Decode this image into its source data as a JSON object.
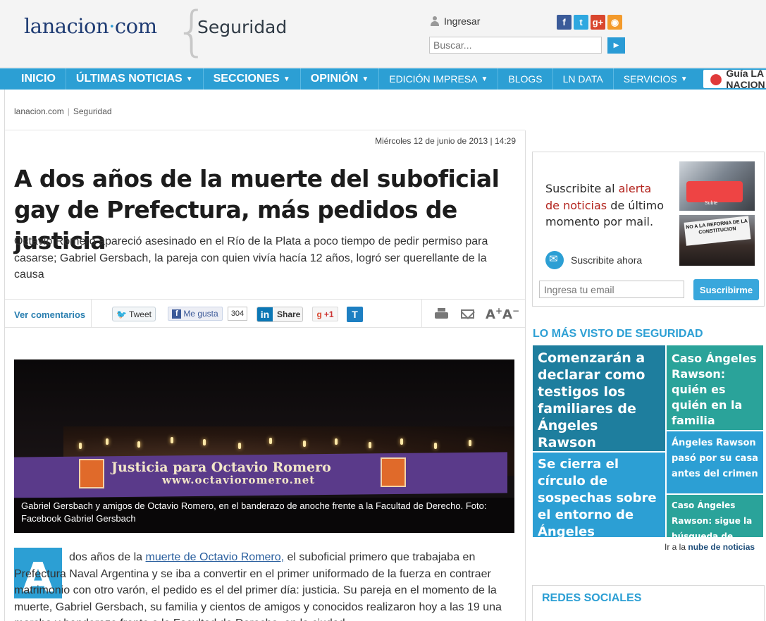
{
  "header": {
    "logo_main": "lanacion",
    "logo_dot": "·",
    "logo_tld": "com",
    "section": "Seguridad",
    "login_label": "Ingresar",
    "search_placeholder": "Buscar...",
    "social_icons": [
      "facebook-icon",
      "twitter-icon",
      "googleplus-icon",
      "rss-icon"
    ]
  },
  "nav": {
    "items": [
      {
        "label": "INICIO",
        "has_caret": false
      },
      {
        "label": "ÚLTIMAS NOTICIAS",
        "has_caret": true
      },
      {
        "label": "SECCIONES",
        "has_caret": true
      },
      {
        "label": "OPINIÓN",
        "has_caret": true
      },
      {
        "label": "EDICIÓN IMPRESA",
        "has_caret": true
      },
      {
        "label": "BLOGS",
        "has_caret": false
      },
      {
        "label": "LN DATA",
        "has_caret": false
      },
      {
        "label": "SERVICIOS",
        "has_caret": true
      }
    ],
    "guia_label": "Guía LA NACION"
  },
  "breadcrumb": {
    "home": "lanacion.com",
    "section": "Seguridad"
  },
  "article": {
    "date": "Miércoles 12 de junio de 2013",
    "time": "14:29",
    "headline": "A dos años de la muerte del suboficial gay de Prefectura, más pedidos de justicia",
    "subhead": "Octavio Romero apareció asesinado en el Río de la Plata a poco tiempo de pedir permiso para casarse; Gabriel Gersbach, la pareja con quien vivía hacía 12 años, logró ser querellante de la causa",
    "photo_caption": "Gabriel Gersbach y amigos de Octavio Romero, en el banderazo de anoche frente a la Facultad de Derecho. Foto: Facebook Gabriel Gersbach",
    "photo_banner_text": "Justicia para Octavio Romero",
    "photo_banner_url": "www.octavioromero.net",
    "dropcap": "A",
    "body_intro": "dos años de la",
    "body_link": "muerte de Octavio Romero,",
    "body_rest": "el suboficial primero que trabajaba en Prefectura Naval Argentina y se iba a convertir en el primer uniformado de la fuerza en contraer matrimonio con otro varón, el pedido es el del primer día: justicia. Su pareja en el momento de la muerte, Gabriel Gersbach, su familia y cientos de amigos y conocidos realizaron hoy a las 19 una marcha y banderazo frente a la Facultad de Derecho, en la ciudad"
  },
  "sharebar": {
    "view_comments": "Ver comentarios",
    "tweet": "Tweet",
    "fb_like": "Me gusta",
    "fb_count": "304",
    "linkedin": "Share",
    "gplus": "+1",
    "t_button": "T",
    "font_plus": "A",
    "font_minus": "A"
  },
  "alert": {
    "text_before": "Suscribite al ",
    "text_highlight": "alerta de noticias",
    "text_after": " de último momento por mail.",
    "subscribe_now": "Suscribite ahora",
    "email_placeholder": "Ingresa tu email",
    "button": "Suscribirme"
  },
  "most_viewed": {
    "title": "LO MÁS VISTO DE SEGURIDAD",
    "tiles": [
      "Comenzarán a declarar como testigos los familiares de Ángeles Rawson",
      "Caso Ángeles Rawson: quién es quién en la familia",
      "Se cierra el círculo de sospechas sobre el entorno de Ángeles",
      "Ángeles Rawson pasó por su casa antes del crimen",
      "Caso Ángeles Rawson: sigue la búsqueda de indicios"
    ],
    "cloud_prefix": "Ir a la",
    "cloud_link": "nube de noticias"
  },
  "redes": {
    "title": "REDES SOCIALES"
  },
  "colors": {
    "accent": "#2c9fd4",
    "logo": "#1e3b73",
    "alert_red": "#b3231d",
    "teal": "#2aa39a",
    "darkblue": "#1e7e9e"
  }
}
